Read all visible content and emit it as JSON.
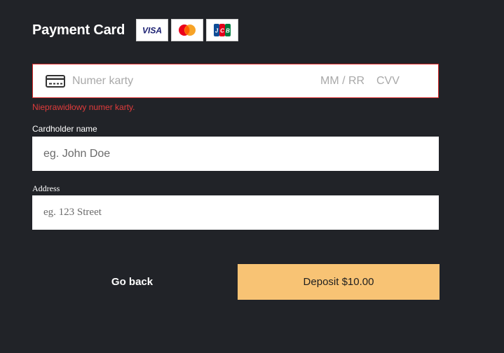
{
  "header": {
    "title": "Payment Card",
    "brands": [
      {
        "name": "VISA",
        "icon": "visa-logo-icon"
      },
      {
        "name": "Mastercard",
        "icon": "mastercard-logo-icon"
      },
      {
        "name": "JCB",
        "icon": "jcb-logo-icon"
      }
    ]
  },
  "card": {
    "number_placeholder": "Numer karty",
    "expiry_placeholder": "MM / RR",
    "cvv_placeholder": "CVV",
    "error": "Nieprawidłowy numer karty.",
    "error_color": "#d92b2b"
  },
  "cardholder": {
    "label": "Cardholder name",
    "placeholder": "eg. John Doe"
  },
  "address": {
    "label": "Address",
    "placeholder": "eg. 123 Street"
  },
  "actions": {
    "back_label": "Go back",
    "deposit_label": "Deposit $10.00",
    "deposit_color": "#f8c374"
  }
}
